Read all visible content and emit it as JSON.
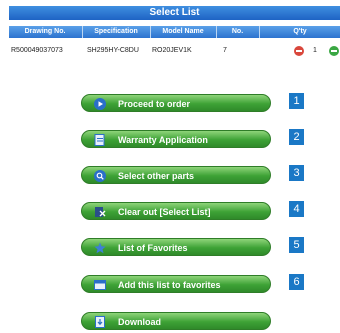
{
  "select_list": {
    "title": "Select List",
    "columns": [
      "Drawing No.",
      "Specification",
      "Model Name",
      "No.",
      "Q'ty"
    ],
    "rows": [
      {
        "drawing_no": "R500049037073",
        "specification": "SH295HY-C8DU",
        "model_name": "RO20JEV1K",
        "no": "7",
        "qty": "1"
      }
    ]
  },
  "buttons": [
    {
      "label": "Proceed to order",
      "icon": "play-icon",
      "number": "1"
    },
    {
      "label": "Warranty Application",
      "icon": "document-icon",
      "number": "2"
    },
    {
      "label": "Select other parts",
      "icon": "search-icon",
      "number": "3"
    },
    {
      "label": "Clear out [Select List]",
      "icon": "clear-icon",
      "number": "4"
    },
    {
      "label": "List of Favorites",
      "icon": "star-icon",
      "number": "5"
    },
    {
      "label": "Add this list to favorites",
      "icon": "add-favorite-icon",
      "number": "6"
    },
    {
      "label": "Download",
      "icon": "download-icon",
      "number": ""
    }
  ],
  "colors": {
    "header_blue": "#2c73cf",
    "button_green": "#3ea236",
    "number_badge": "#1a78c6",
    "minus_red": "#d9473c",
    "plus_green": "#3aa743"
  }
}
